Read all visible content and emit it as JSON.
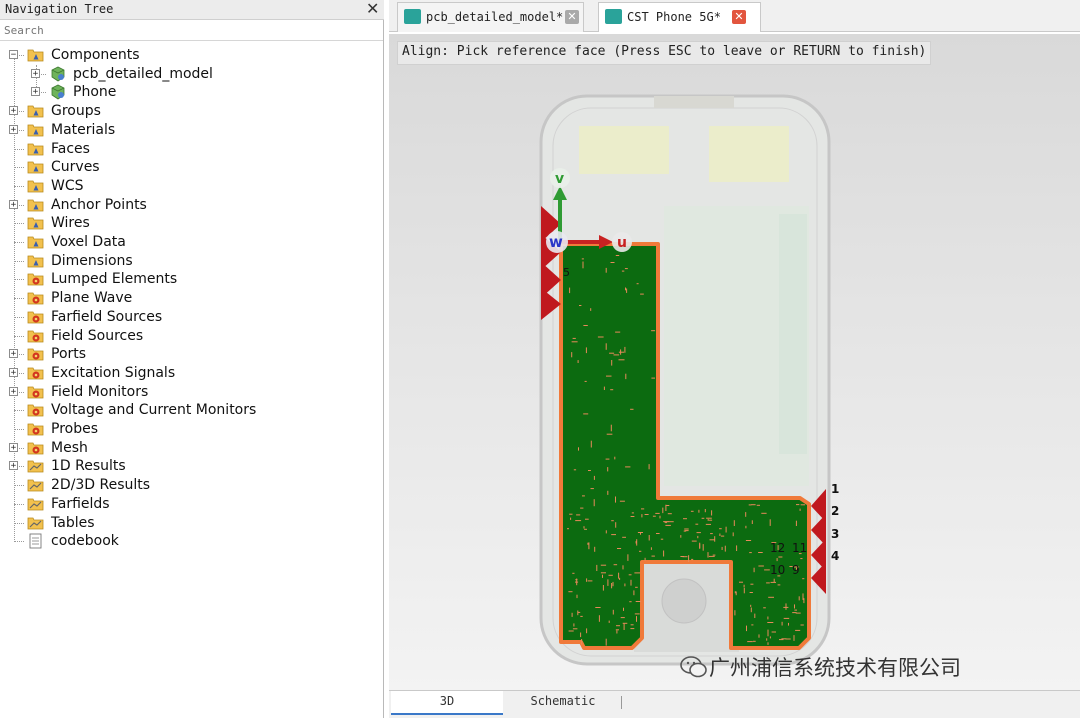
{
  "nav": {
    "title": "Navigation Tree",
    "close_glyph": "✕",
    "search_placeholder": "Search",
    "items": [
      {
        "label": "Components",
        "expander": "−",
        "icon": "folder-icon"
      },
      {
        "label": "pcb_detailed_model",
        "expander": "+",
        "icon": "component-icon"
      },
      {
        "label": "Phone",
        "expander": "+",
        "icon": "component-icon"
      },
      {
        "label": "Groups",
        "expander": "+",
        "icon": "folder-icon"
      },
      {
        "label": "Materials",
        "expander": "+",
        "icon": "folder-icon"
      },
      {
        "label": "Faces",
        "expander": "",
        "icon": "folder-icon"
      },
      {
        "label": "Curves",
        "expander": "",
        "icon": "folder-icon"
      },
      {
        "label": "WCS",
        "expander": "",
        "icon": "folder-icon"
      },
      {
        "label": "Anchor Points",
        "expander": "+",
        "icon": "folder-icon"
      },
      {
        "label": "Wires",
        "expander": "",
        "icon": "folder-icon"
      },
      {
        "label": "Voxel Data",
        "expander": "",
        "icon": "folder-icon"
      },
      {
        "label": "Dimensions",
        "expander": "",
        "icon": "folder-icon"
      },
      {
        "label": "Lumped Elements",
        "expander": "",
        "icon": "folder-gear-icon"
      },
      {
        "label": "Plane Wave",
        "expander": "",
        "icon": "folder-gear-icon"
      },
      {
        "label": "Farfield Sources",
        "expander": "",
        "icon": "folder-gear-icon"
      },
      {
        "label": "Field Sources",
        "expander": "",
        "icon": "folder-gear-icon"
      },
      {
        "label": "Ports",
        "expander": "+",
        "icon": "folder-gear-icon"
      },
      {
        "label": "Excitation Signals",
        "expander": "+",
        "icon": "folder-gear-icon"
      },
      {
        "label": "Field Monitors",
        "expander": "+",
        "icon": "folder-gear-icon"
      },
      {
        "label": "Voltage and Current Monitors",
        "expander": "",
        "icon": "folder-gear-icon"
      },
      {
        "label": "Probes",
        "expander": "",
        "icon": "folder-gear-icon"
      },
      {
        "label": "Mesh",
        "expander": "+",
        "icon": "folder-gear-icon"
      },
      {
        "label": "1D Results",
        "expander": "+",
        "icon": "results-folder-icon"
      },
      {
        "label": "2D/3D Results",
        "expander": "",
        "icon": "results-folder-icon"
      },
      {
        "label": "Farfields",
        "expander": "",
        "icon": "results-folder-icon"
      },
      {
        "label": "Tables",
        "expander": "",
        "icon": "results-folder-icon"
      },
      {
        "label": "codebook",
        "expander": "",
        "icon": "document-icon"
      }
    ]
  },
  "tabs": [
    {
      "label": "pcb_detailed_model*",
      "close": "✕",
      "active": false
    },
    {
      "label": "CST Phone 5G*",
      "close": "✕",
      "active": true
    }
  ],
  "viewport": {
    "status": "Align: Pick reference face (Press ESC to leave or RETURN to finish)",
    "axis_v": "v",
    "axis_w": "w",
    "axis_u": "u",
    "port_labels": [
      "5",
      "1",
      "2",
      "3",
      "4",
      "12",
      "11",
      "10",
      "9"
    ],
    "watermark": "广州浦信系统技术有限公司"
  },
  "bottom_tabs": [
    {
      "label": "3D",
      "active": true
    },
    {
      "label": "Schematic",
      "active": false
    }
  ],
  "colors": {
    "pcb_green": "#0c6b10",
    "pcb_outline": "#f07a3a",
    "port_red": "#c0191e",
    "tab_close": "#e2553e",
    "axis_green": "#2f9b33",
    "axis_red": "#c82222",
    "axis_blue": "#2a35c8"
  }
}
